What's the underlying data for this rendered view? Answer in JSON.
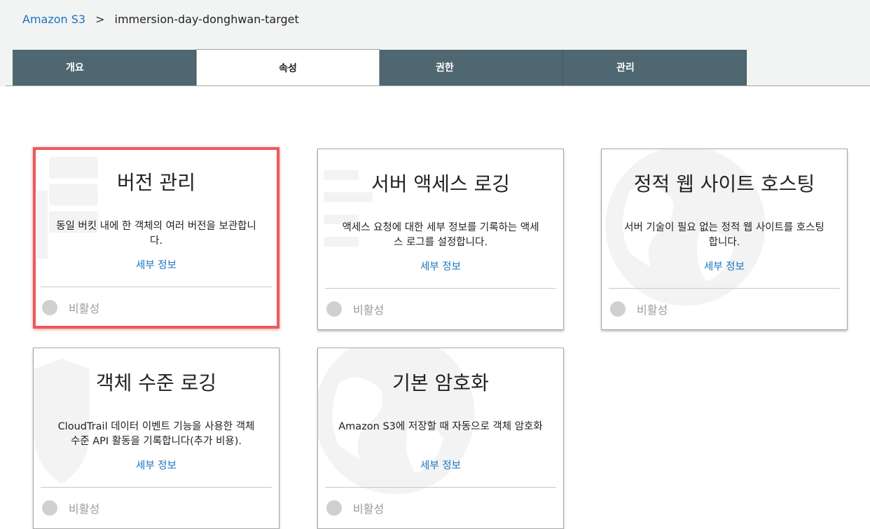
{
  "breadcrumb": {
    "root": "Amazon S3",
    "separator": ">",
    "current": "immersion-day-donghwan-target"
  },
  "tabs": [
    {
      "label": "개요",
      "active": false
    },
    {
      "label": "속성",
      "active": true
    },
    {
      "label": "권한",
      "active": false
    },
    {
      "label": "관리",
      "active": false
    }
  ],
  "cards": [
    {
      "title": "버전 관리",
      "description": "동일 버킷 내에 한 객체의 여러 버전을 보관합니다.",
      "link": "세부 정보",
      "status": "비활성",
      "highlighted": true,
      "icon": "version-stack-icon"
    },
    {
      "title": "서버 액세스 로깅",
      "description": "액세스 요청에 대한 세부 정보를 기록하는 액세스 로그를 설정합니다.",
      "link": "세부 정보",
      "status": "비활성",
      "highlighted": false,
      "icon": "log-list-icon"
    },
    {
      "title": "정적 웹 사이트 호스팅",
      "description": "서버 기술이 필요 없는 정적 웹 사이트를 호스팅합니다.",
      "link": "세부 정보",
      "status": "비활성",
      "highlighted": false,
      "icon": "globe-icon"
    },
    {
      "title": "객체 수준 로깅",
      "description": "CloudTrail 데이터 이벤트 기능을 사용한 객체 수준 API 활동을 기록합니다(추가 비용).",
      "link": "세부 정보",
      "status": "비활성",
      "highlighted": false,
      "icon": "shield-icon"
    },
    {
      "title": "기본 암호화",
      "description": "Amazon S3에 저장할 때 자동으로 객체 암호화",
      "link": "세부 정보",
      "status": "비활성",
      "highlighted": false,
      "icon": "globe-icon"
    }
  ],
  "colors": {
    "tab_inactive_bg": "#4f6770",
    "link": "#1a73c1",
    "highlight_border": "#ec5a5e",
    "status_gray": "#9a9a9a"
  }
}
